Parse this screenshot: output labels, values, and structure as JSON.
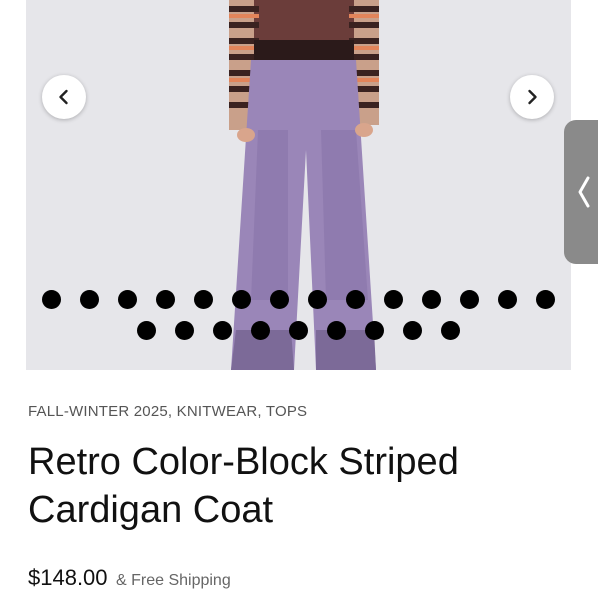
{
  "product": {
    "categories": "FALL-WINTER 2025, KNITWEAR, TOPS",
    "title_line1": "Retro Color-Block Striped",
    "title_line2": "Cardigan Coat",
    "price": "$148.00",
    "shipping": "& Free Shipping"
  },
  "gallery": {
    "prev_icon": "chevron-left-icon",
    "next_icon": "chevron-right-icon",
    "slide_count": 23,
    "dots_row1": 14,
    "dots_row2": 9
  },
  "side_tab": {
    "icon": "chevron-left-icon"
  },
  "colors": {
    "pants": "#9a86b8",
    "dots": "#000000",
    "side_tab": "#8a8a8a"
  }
}
